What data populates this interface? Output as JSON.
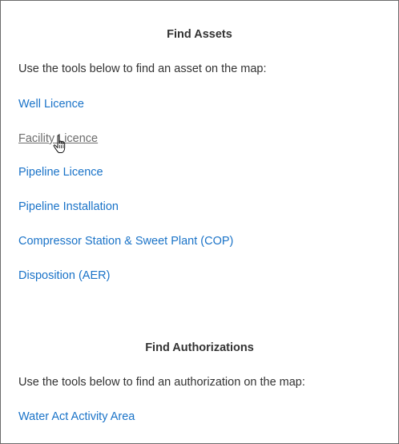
{
  "find_assets": {
    "title": "Find Assets",
    "intro": "Use the tools below to find an asset on the map:",
    "links": [
      {
        "label": "Well Licence"
      },
      {
        "label": "Facility Licence"
      },
      {
        "label": "Pipeline Licence"
      },
      {
        "label": "Pipeline Installation"
      },
      {
        "label": "Compressor Station & Sweet Plant (COP)"
      },
      {
        "label": "Disposition (AER)"
      }
    ]
  },
  "find_authorizations": {
    "title": "Find Authorizations",
    "intro": "Use the tools below to find an authorization on the map:",
    "links": [
      {
        "label": "Water Act Activity Area"
      }
    ]
  },
  "cursor": {
    "icon": "hand-pointer-icon"
  },
  "colors": {
    "link": "#1a73c8",
    "hovered_link": "#6d6d6d",
    "text": "#333333",
    "border": "#6b6b6b"
  }
}
